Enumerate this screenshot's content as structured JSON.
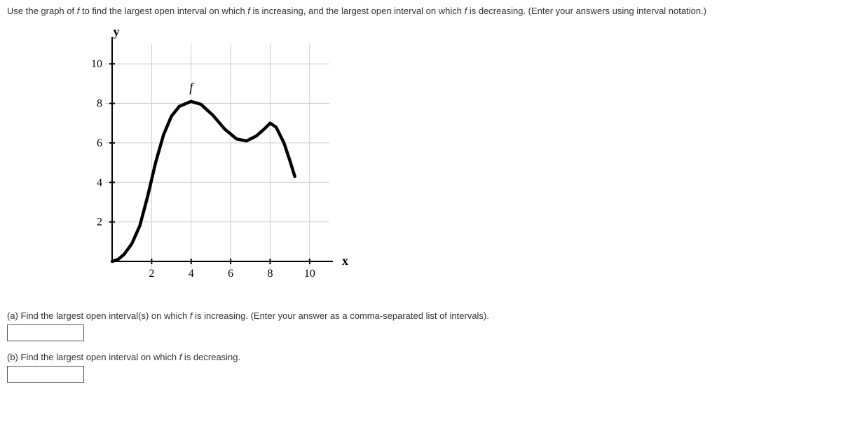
{
  "prompt_html": "Use the graph of <i>f</i> to find the largest open interval on which <i>f</i> is increasing, and the largest open interval on which <i>f</i> is decreasing. (Enter your answers using interval notation.)",
  "chart_data": {
    "type": "line",
    "title": "",
    "xlabel": "x",
    "ylabel": "y",
    "func_label": "f",
    "xlim": [
      0,
      11
    ],
    "ylim": [
      0,
      11
    ],
    "x_ticks": [
      2,
      4,
      6,
      8,
      10
    ],
    "y_ticks": [
      2,
      4,
      6,
      8,
      10
    ],
    "series": [
      {
        "name": "f",
        "points": [
          [
            0,
            0
          ],
          [
            0.3,
            0.1
          ],
          [
            0.6,
            0.35
          ],
          [
            1.0,
            0.9
          ],
          [
            1.4,
            1.8
          ],
          [
            1.8,
            3.3
          ],
          [
            2.2,
            5.0
          ],
          [
            2.6,
            6.4
          ],
          [
            3.0,
            7.35
          ],
          [
            3.4,
            7.85
          ],
          [
            4.0,
            8.1
          ],
          [
            4.5,
            7.95
          ],
          [
            5.1,
            7.4
          ],
          [
            5.7,
            6.7
          ],
          [
            6.3,
            6.2
          ],
          [
            6.8,
            6.1
          ],
          [
            7.3,
            6.35
          ],
          [
            7.7,
            6.7
          ],
          [
            8.0,
            7.0
          ],
          [
            8.3,
            6.8
          ],
          [
            8.7,
            6.0
          ],
          [
            9.0,
            5.1
          ],
          [
            9.25,
            4.3
          ]
        ]
      }
    ]
  },
  "parts": {
    "a": {
      "prompt_html": "(a) Find the largest open interval(s) on which <i>f</i> is increasing. (Enter your answer as a comma-separated list of intervals).",
      "value": ""
    },
    "b": {
      "prompt_html": "(b) Find the largest open interval on which <i>f</i> is decreasing.",
      "value": ""
    }
  }
}
